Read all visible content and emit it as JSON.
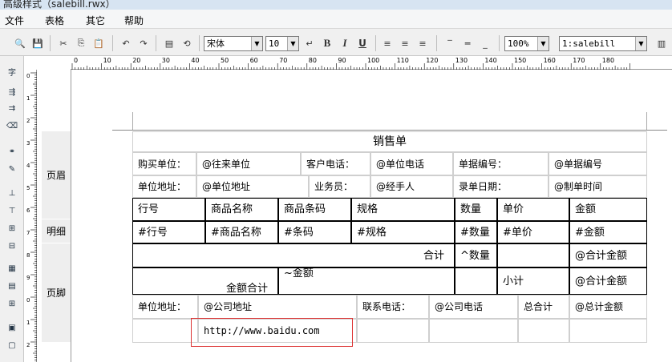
{
  "window": {
    "title": "高级样式（salebill.rwx）"
  },
  "menu": [
    "文件",
    "表格",
    "其它",
    "帮助"
  ],
  "toolbar": {
    "font": "宋体",
    "font_size": "10",
    "bold": "B",
    "italic": "I",
    "underline": "U",
    "zoom": "100%",
    "sheet": "1:salebill"
  },
  "ruler_ticks": [
    "0",
    "10",
    "20",
    "30",
    "40",
    "50",
    "60",
    "70",
    "80",
    "90",
    "100",
    "110",
    "120",
    "130",
    "140",
    "150",
    "160",
    "170",
    "180"
  ],
  "vruler_ticks": [
    "0",
    "1",
    "2",
    "3",
    "4",
    "5",
    "6",
    "7",
    "8",
    "9",
    "0",
    "1",
    "2"
  ],
  "bands": {
    "header": "页眉",
    "detail": "明细",
    "footer": "页脚"
  },
  "report": {
    "title": "销售单",
    "r1": [
      "购买单位：",
      "@往来单位",
      "客户电话：",
      "@单位电话",
      "单据编号：",
      "@单据编号"
    ],
    "r2": [
      "单位地址：",
      "@单位地址",
      "业务员：",
      "@经手人",
      "录单日期：",
      "@制单时间"
    ],
    "head": [
      "行号",
      "商品名称",
      "商品条码",
      "规格",
      "数量",
      "单价",
      "金额"
    ],
    "detail": [
      "#行号",
      "#商品名称",
      "#条码",
      "#规格",
      "#数量",
      "#单价",
      "#金额"
    ],
    "total": {
      "label": "合计",
      "qty": "^数量",
      "amount": "@合计金额"
    },
    "amt": {
      "label": "金额合计",
      "value": "~金额",
      "sub": "小计",
      "subv": "@合计金额"
    },
    "foot": [
      "单位地址：",
      "@公司地址",
      "联系电话：",
      "@公司电话",
      "总合计",
      "@总计金额"
    ],
    "url": "http://www.baidu.com"
  }
}
